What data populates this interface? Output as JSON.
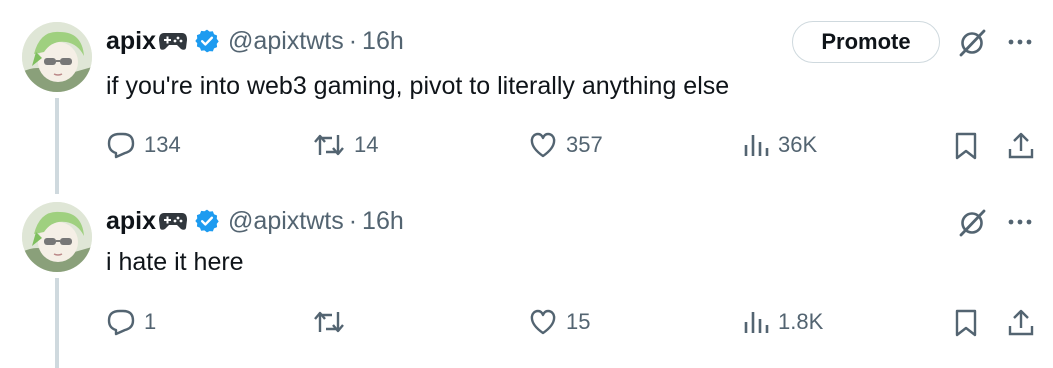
{
  "tweets": [
    {
      "name": "apix",
      "handle": "@apixtwts",
      "separator": "·",
      "time": "16h",
      "text": "if you're into web3 gaming, pivot to literally anything else",
      "promote_label": "Promote",
      "replies": "134",
      "reposts": "14",
      "likes": "357",
      "views": "36K"
    },
    {
      "name": "apix",
      "handle": "@apixtwts",
      "separator": "·",
      "time": "16h",
      "text": "i hate it here",
      "replies": "1",
      "reposts": "",
      "likes": "15",
      "views": "1.8K"
    }
  ],
  "colors": {
    "text": "#0f1419",
    "secondary": "#536471",
    "verified": "#1d9bf0",
    "thread_line": "#cfd9de"
  },
  "icons": [
    "gamepad-icon",
    "verified-badge-icon",
    "grok-icon",
    "more-icon",
    "reply-icon",
    "repost-icon",
    "like-icon",
    "views-icon",
    "bookmark-icon",
    "share-icon"
  ]
}
